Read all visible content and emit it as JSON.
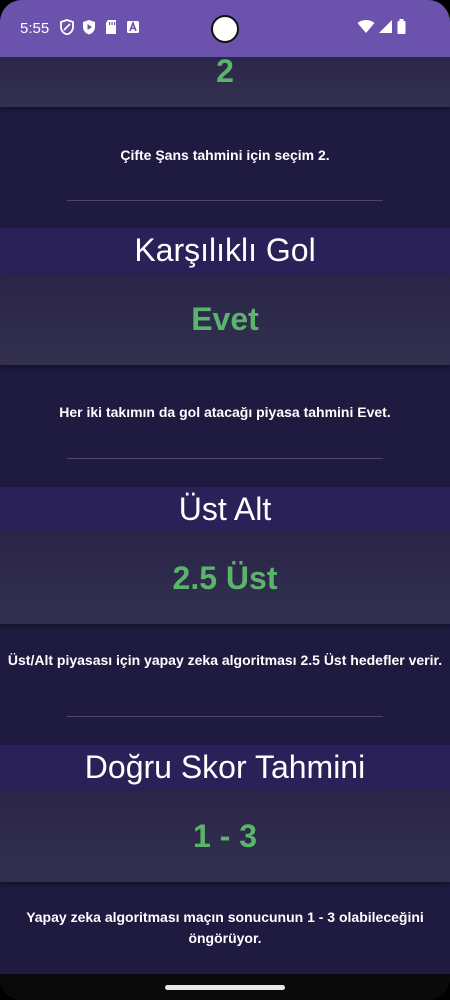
{
  "status_bar": {
    "time": "5:55",
    "icons_left": [
      "shield-icon",
      "play-protect-icon",
      "sd-card-icon",
      "font-a-icon"
    ],
    "icons_right": [
      "wifi-icon",
      "signal-icon",
      "battery-icon"
    ],
    "color": "#6a52ad"
  },
  "sections": [
    {
      "value": "2",
      "description": "Çifte Şans tahmini için seçim 2."
    },
    {
      "header": "Karşılıklı Gol",
      "value": "Evet",
      "description": "Her iki takımın da gol atacağı piyasa tahmini Evet."
    },
    {
      "header": "Üst Alt",
      "value": "2.5 Üst",
      "description": "Üst/Alt piyasası için yapay zeka algoritması 2.5 Üst  hedefler verir."
    },
    {
      "header": "Doğru Skor Tahmini",
      "value": "1 - 3",
      "description": "Yapay zeka algoritması maçın sonucunun 1 - 3 olabileceğini öngörüyor."
    }
  ],
  "colors": {
    "value_text": "#5ab56a",
    "background": "#1e1a40",
    "header_background": "#2b2159"
  }
}
